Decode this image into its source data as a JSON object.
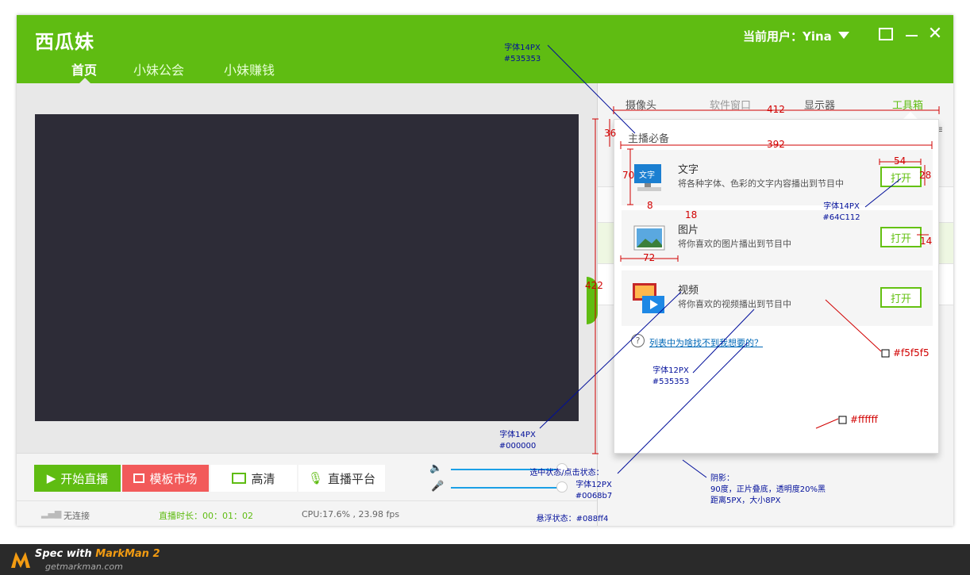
{
  "app": {
    "logo": "西瓜妹",
    "nav": [
      {
        "label": "首页"
      },
      {
        "label": "小妹公会"
      },
      {
        "label": "小妹赚钱"
      }
    ],
    "user_label": "当前用户：Yina",
    "right_tabs": [
      {
        "label": "摄像头"
      },
      {
        "label": "软件窗口"
      },
      {
        "label": "显示器"
      },
      {
        "label": "工具箱"
      }
    ]
  },
  "toolbar": {
    "start_label": "开始直播",
    "template_label": "模板市场",
    "hd_label": "高清",
    "platform_label": "直播平台"
  },
  "status": {
    "connection": "无连接",
    "duration": "直播时长：00：01：02",
    "cpu": "CPU:17.6% , 23.98 fps"
  },
  "popup": {
    "title": "主播必备",
    "items": [
      {
        "name": "文字",
        "desc": "将各种字体、色彩的文字内容播出到节目中",
        "button": "打开"
      },
      {
        "name": "图片",
        "desc": "将你喜欢的图片播出到节目中",
        "button": "打开"
      },
      {
        "name": "视频",
        "desc": "将你喜欢的视频播出到节目中",
        "button": "打开"
      }
    ],
    "help_link": "列表中为啥找不到我想要的？"
  },
  "annotations": {
    "top_font": "字体14PX",
    "top_color": "#535353",
    "dim_412": "412",
    "dim_36": "36",
    "dim_392": "392",
    "dim_54": "54",
    "dim_28": "28",
    "dim_70": "70",
    "dim_8": "8",
    "dim_18": "18",
    "dim_72": "72",
    "dim_14": "14",
    "dim_422": "422",
    "btn_font": "字体14PX",
    "btn_color": "#64C112",
    "bg_gray": "#f5f5f5",
    "bg_white": "#ffffff",
    "desc_font": "字体12PX",
    "desc_color": "#535353",
    "name_font": "字体14PX",
    "name_color": "#000000",
    "selected_state": "选中状态/点击状态：",
    "link_font": "字体12PX",
    "link_color": "#0068b7",
    "hover_state": "悬浮状态：#088ff4",
    "shadow_title": "阴影：",
    "shadow_line1": "90度，正片叠底，透明度20%黑",
    "shadow_line2": "距离5PX，大小8PX"
  },
  "footer": {
    "brand_prefix": "Spec with ",
    "brand_name": "MarkMan 2",
    "url": "getmarkman.com"
  }
}
